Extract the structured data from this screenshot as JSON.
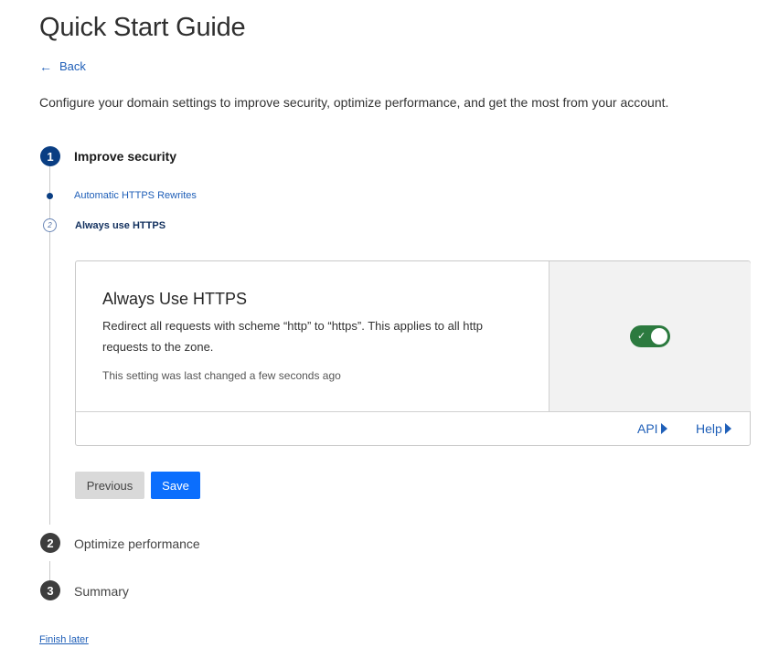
{
  "header": {
    "title": "Quick Start Guide",
    "back_label": "Back",
    "intro": "Configure your domain settings to improve security, optimize performance, and get the most from your account."
  },
  "steps": [
    {
      "number": "1",
      "label": "Improve security",
      "state": "active"
    },
    {
      "number": "2",
      "label": "Optimize performance",
      "state": "pending"
    },
    {
      "number": "3",
      "label": "Summary",
      "state": "pending"
    }
  ],
  "substeps": [
    {
      "label": "Automatic HTTPS Rewrites",
      "state": "done"
    },
    {
      "label": "Always use HTTPS",
      "state": "current",
      "marker": "2"
    }
  ],
  "card": {
    "title": "Always Use HTTPS",
    "description": "Redirect all requests with scheme “http” to “https”. This applies to all http requests to the zone.",
    "note": "This setting was last changed a few seconds ago",
    "toggle_on": true,
    "api_label": "API",
    "help_label": "Help"
  },
  "buttons": {
    "previous": "Previous",
    "save": "Save"
  },
  "finish_later": "Finish later",
  "colors": {
    "accent": "#0b6efd",
    "step_active": "#0a3e83",
    "toggle_on": "#2c7a3f",
    "link": "#1f5fb8"
  }
}
